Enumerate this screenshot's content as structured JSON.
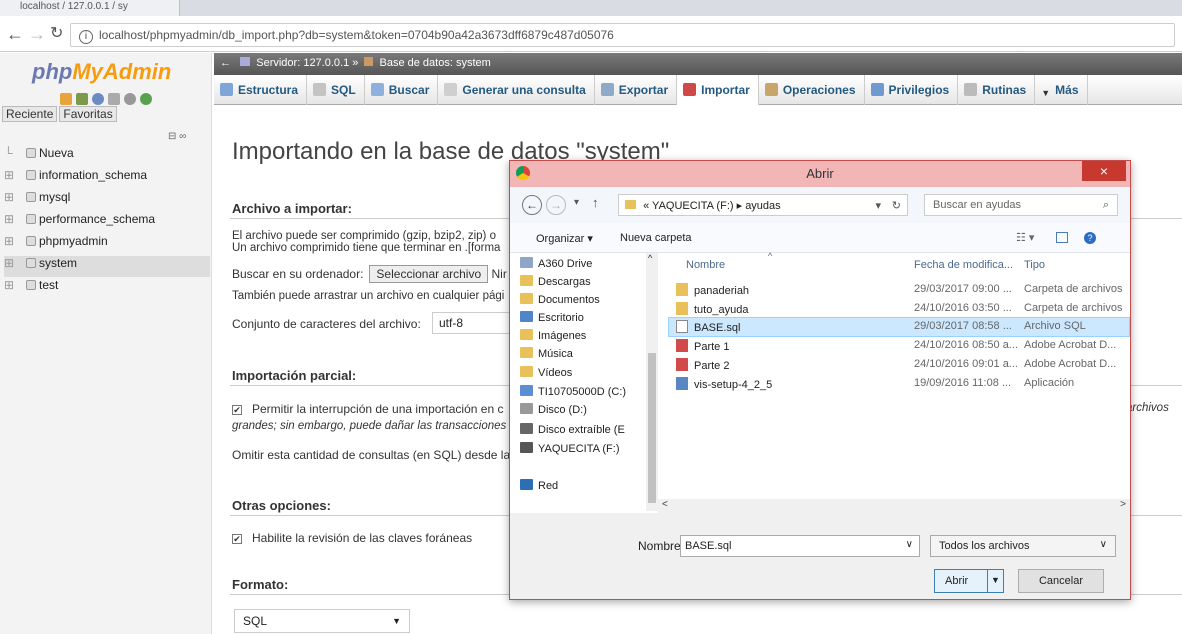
{
  "browser": {
    "tab_title": "localhost / 127.0.0.1 / sy",
    "url": "localhost/phpmyadmin/db_import.php?db=system&token=0704b90a42a3673dff6879c487d05076"
  },
  "nav": {
    "logo_php": "php",
    "logo_my": "MyAdmin",
    "recent": "Reciente",
    "favorites": "Favoritas",
    "databases": [
      "Nueva",
      "information_schema",
      "mysql",
      "performance_schema",
      "phpmyadmin",
      "system",
      "test"
    ],
    "selected": "system"
  },
  "breadcrumb": {
    "server": "Servidor: 127.0.0.1",
    "sep": "»",
    "database": "Base de datos: system"
  },
  "tabs": [
    "Estructura",
    "SQL",
    "Buscar",
    "Generar una consulta",
    "Exportar",
    "Importar",
    "Operaciones",
    "Privilegios",
    "Rutinas",
    "Más"
  ],
  "main": {
    "title": "Importando en la base de datos \"system\"",
    "file_section": "Archivo a importar:",
    "file_desc1": "El archivo puede ser comprimido (gzip, bzip2, zip) o",
    "file_desc2": "Un archivo comprimido tiene que terminar en .[forma",
    "browse_label": "Buscar en su ordenador:",
    "select_button": "Seleccionar archivo",
    "no_file": "Nir",
    "drag_text": "También puede arrastrar un archivo en cualquier pági",
    "charset_label": "Conjunto de caracteres del archivo:",
    "charset_value": "utf-8",
    "partial_section": "Importación parcial:",
    "partial_opt1": "Permitir la interrupción de una importación en c",
    "partial_opt1_end": "archivos",
    "partial_opt1_line2": "grandes; sin embargo, puede dañar las transacciones",
    "skip_text": "Omitir esta cantidad de consultas (en SQL) desde la",
    "other_section": "Otras opciones:",
    "fk_label": "Habilite la revisión de las claves foráneas",
    "format_section": "Formato:",
    "format_value": "SQL"
  },
  "dialog": {
    "title": "Abrir",
    "close": "×",
    "path_root": "«",
    "path": [
      "YAQUECITA (F:)",
      "ayudas"
    ],
    "search_placeholder": "Buscar en ayudas",
    "organize": "Organizar ▾",
    "new_folder": "Nueva carpeta",
    "nav_items": [
      "A360 Drive",
      "Descargas",
      "Documentos",
      "Escritorio",
      "Imágenes",
      "Música",
      "Vídeos",
      "TI10705000D (C:)",
      "Disco (D:)",
      "Disco extraíble (E",
      "YAQUECITA (F:)",
      "Red"
    ],
    "col_name": "Nombre",
    "col_date": "Fecha de modifica...",
    "col_type": "Tipo",
    "files": [
      {
        "name": "panaderiah",
        "date": "29/03/2017 09:00 ...",
        "type": "Carpeta de archivos",
        "icon": "folder-icon"
      },
      {
        "name": "tuto_ayuda",
        "date": "24/10/2016 03:50 ...",
        "type": "Carpeta de archivos",
        "icon": "folder-icon"
      },
      {
        "name": "BASE.sql",
        "date": "29/03/2017 08:58 ...",
        "type": "Archivo SQL",
        "icon": "file-icon"
      },
      {
        "name": "Parte 1",
        "date": "24/10/2016 08:50 a...",
        "type": "Adobe Acrobat D...",
        "icon": "pdf-icon"
      },
      {
        "name": "Parte 2",
        "date": "24/10/2016 09:01 a...",
        "type": "Adobe Acrobat D...",
        "icon": "pdf-icon"
      },
      {
        "name": "vis-setup-4_2_5",
        "date": "19/09/2016 11:08 ...",
        "type": "Aplicación",
        "icon": "app-icon"
      }
    ],
    "filename_label": "Nombre:",
    "filename_value": "BASE.sql",
    "filter_value": "Todos los archivos",
    "open_button": "Abrir",
    "cancel_button": "Cancelar"
  }
}
